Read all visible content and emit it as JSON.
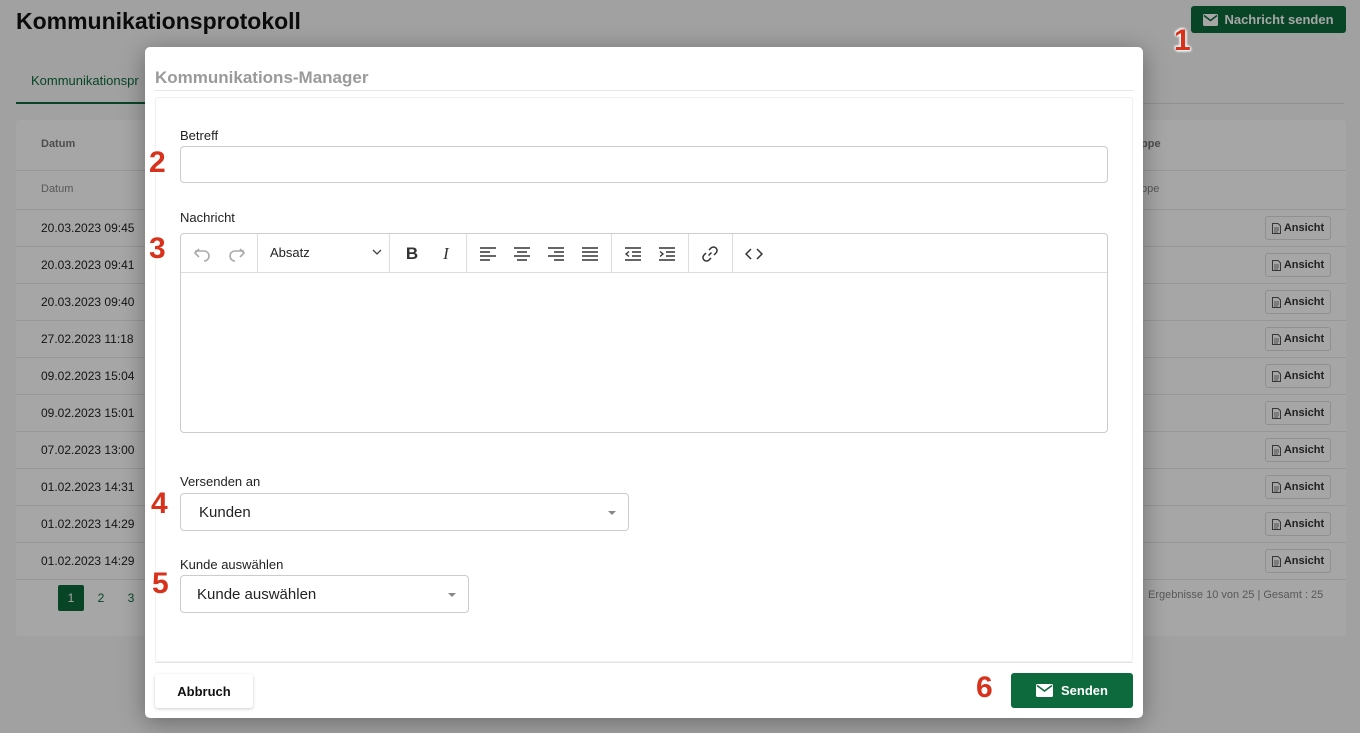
{
  "page": {
    "title": "Kommunikationsprotokoll",
    "send_message_button": "Nachricht senden",
    "active_tab": "Kommunikationspr",
    "table": {
      "header_date": "Datum",
      "header_right": "ppe",
      "filter_date": "Datum",
      "filter_right": "ppe",
      "rows": [
        "20.03.2023 09:45",
        "20.03.2023 09:41",
        "20.03.2023 09:40",
        "27.02.2023 11:18",
        "09.02.2023 15:04",
        "09.02.2023 15:01",
        "07.02.2023 13:00",
        "01.02.2023 14:31",
        "01.02.2023 14:29",
        "01.02.2023 14:29"
      ],
      "view_button": "Ansicht",
      "pages": [
        "1",
        "2",
        "3"
      ],
      "results_text": "Ergebnisse 10 von 25 | Gesamt : 25"
    }
  },
  "modal": {
    "title": "Kommunikations-Manager",
    "subject_label": "Betreff",
    "subject_value": "",
    "message_label": "Nachricht",
    "paragraph_select": "Absatz",
    "send_to_label": "Versenden an",
    "send_to_value": "Kunden",
    "customer_label": "Kunde auswählen",
    "customer_value": "Kunde auswählen",
    "cancel_button": "Abbruch",
    "send_button": "Senden"
  },
  "markers": [
    "1",
    "2",
    "3",
    "4",
    "5",
    "6"
  ],
  "colors": {
    "primary": "#0d6a3c",
    "marker": "#d8321c"
  }
}
